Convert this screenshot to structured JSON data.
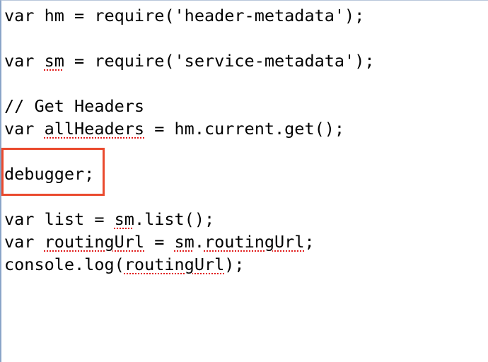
{
  "editor": {
    "lines": [
      {
        "parts": [
          {
            "t": "var hm = require('header-metadata');"
          }
        ]
      },
      {
        "parts": [
          {
            "t": ""
          }
        ]
      },
      {
        "parts": [
          {
            "t": "var "
          },
          {
            "t": "sm",
            "spell": true
          },
          {
            "t": " = require('service-metadata');"
          }
        ]
      },
      {
        "parts": [
          {
            "t": ""
          }
        ]
      },
      {
        "parts": [
          {
            "t": "// Get Headers"
          }
        ]
      },
      {
        "parts": [
          {
            "t": "var "
          },
          {
            "t": "allHeaders",
            "spell": true
          },
          {
            "t": " = hm.current.get();"
          }
        ]
      },
      {
        "parts": [
          {
            "t": ""
          }
        ]
      },
      {
        "parts": [
          {
            "t": "debugger;"
          }
        ]
      },
      {
        "parts": [
          {
            "t": ""
          }
        ]
      },
      {
        "parts": [
          {
            "t": "var list = "
          },
          {
            "t": "sm",
            "spell": true
          },
          {
            "t": ".list();"
          }
        ]
      },
      {
        "parts": [
          {
            "t": "var "
          },
          {
            "t": "routingUrl",
            "spell": true
          },
          {
            "t": " = "
          },
          {
            "t": "sm",
            "spell": true
          },
          {
            "t": "."
          },
          {
            "t": "routingUrl",
            "spell": true
          },
          {
            "t": ";"
          }
        ]
      },
      {
        "parts": [
          {
            "t": "console.log("
          },
          {
            "t": "routingUrl",
            "spell": true
          },
          {
            "t": ");"
          }
        ]
      }
    ],
    "highlight_color": "#ea4a2e",
    "spell_color": "#e11b1b"
  }
}
